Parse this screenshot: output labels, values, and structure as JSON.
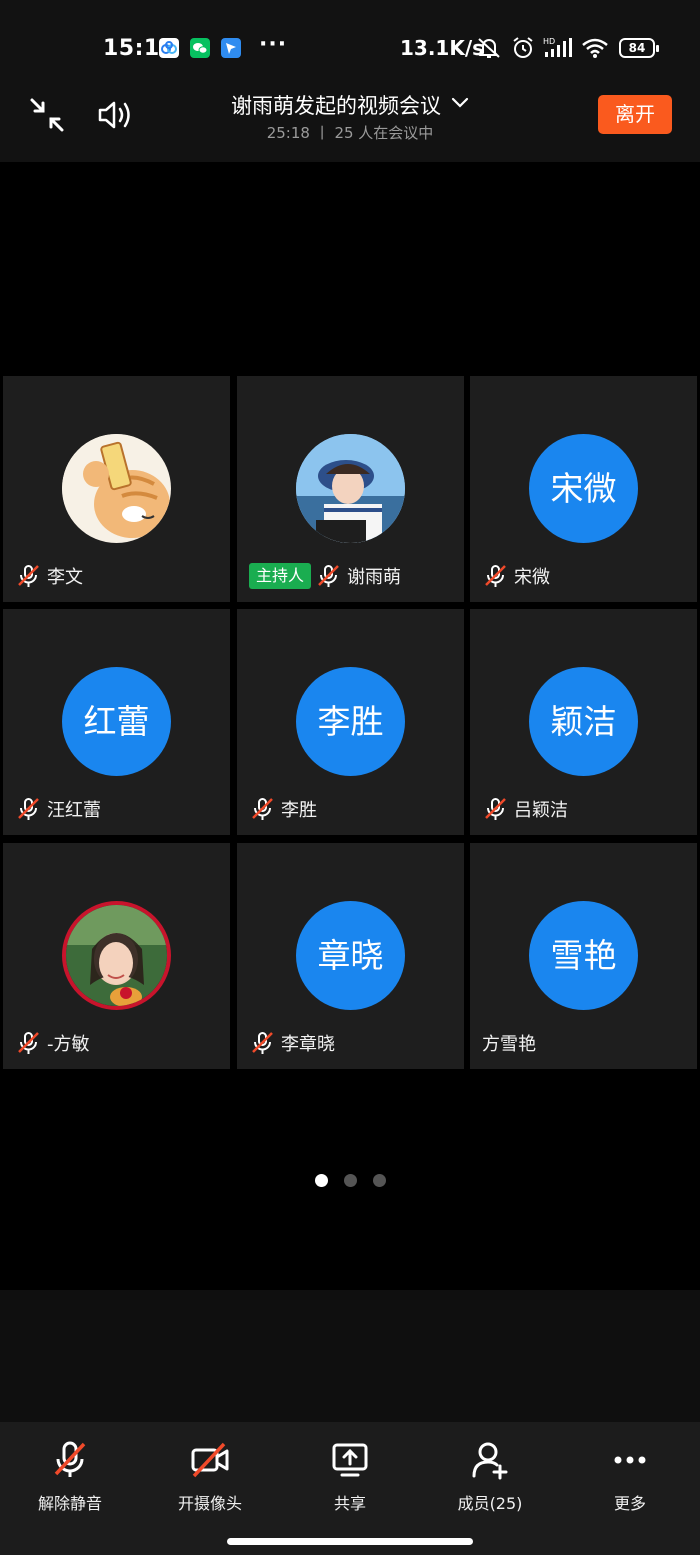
{
  "status_bar": {
    "time": "15:19",
    "speed": "13.1K/s",
    "battery": "84",
    "icons": [
      "baidu-netdisk-icon",
      "wechat-icon",
      "app-icon",
      "more-dots-icon",
      "mute-notification-icon",
      "alarm-icon",
      "hd-signal-icon",
      "wifi-icon",
      "battery-icon"
    ]
  },
  "header": {
    "title": "谢雨萌发起的视频会议",
    "subtitle": "25:18 丨 25 人在会议中",
    "leave_label": "离开"
  },
  "participants": [
    {
      "name": "李文",
      "avatar_type": "image",
      "avatar_desc": "cat-sticker",
      "muted": true,
      "host": false
    },
    {
      "name": "谢雨萌",
      "avatar_type": "image",
      "avatar_desc": "girl-photo",
      "muted": true,
      "host": true
    },
    {
      "name": "宋微",
      "avatar_type": "text",
      "avatar_text": "宋微",
      "muted": true,
      "host": false
    },
    {
      "name": "汪红蕾",
      "avatar_type": "text",
      "avatar_text": "红蕾",
      "muted": true,
      "host": false
    },
    {
      "name": "李胜",
      "avatar_type": "text",
      "avatar_text": "李胜",
      "muted": true,
      "host": false
    },
    {
      "name": "吕颖洁",
      "avatar_type": "text",
      "avatar_text": "颖洁",
      "muted": true,
      "host": false
    },
    {
      "name": "-方敏",
      "avatar_type": "image",
      "avatar_desc": "woman-photo",
      "muted": true,
      "host": false
    },
    {
      "name": "李章晓",
      "avatar_type": "text",
      "avatar_text": "章晓",
      "muted": true,
      "host": false
    },
    {
      "name": "方雪艳",
      "avatar_type": "text",
      "avatar_text": "雪艳",
      "muted": false,
      "host": false
    }
  ],
  "host_label": "主持人",
  "pagination": {
    "pages": 3,
    "current": 1
  },
  "toolbar": {
    "unmute": "解除静音",
    "camera": "开摄像头",
    "share": "共享",
    "members": "成员(25)",
    "more": "更多"
  },
  "colors": {
    "accent_blue": "#1a86ef",
    "leave_orange": "#fa5a1e",
    "host_green": "#1aad50",
    "mute_red": "#f04a2a"
  }
}
